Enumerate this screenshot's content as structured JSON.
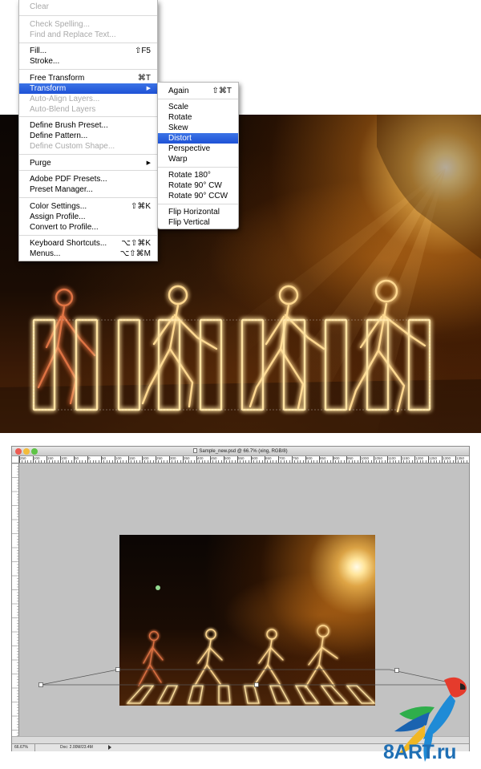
{
  "edit_menu": {
    "items": [
      {
        "label": "Clear",
        "disabled": true
      },
      {
        "label": "Check Spelling...",
        "disabled": true
      },
      {
        "label": "Find and Replace Text...",
        "disabled": true
      },
      {
        "label": "Fill...",
        "shortcut": "⇧F5"
      },
      {
        "label": "Stroke..."
      },
      {
        "label": "Free Transform",
        "shortcut": "⌘T"
      },
      {
        "label": "Transform",
        "selected": true,
        "submenu_arrow": "▶"
      },
      {
        "label": "Auto-Align Layers...",
        "disabled": true
      },
      {
        "label": "Auto-Blend Layers",
        "disabled": true
      },
      {
        "label": "Define Brush Preset..."
      },
      {
        "label": "Define Pattern..."
      },
      {
        "label": "Define Custom Shape...",
        "disabled": true
      },
      {
        "label": "Purge",
        "submenu_arrow": "▶"
      },
      {
        "label": "Adobe PDF Presets..."
      },
      {
        "label": "Preset Manager..."
      },
      {
        "label": "Color Settings...",
        "shortcut": "⇧⌘K"
      },
      {
        "label": "Assign Profile..."
      },
      {
        "label": "Convert to Profile..."
      },
      {
        "label": "Keyboard Shortcuts...",
        "shortcut": "⌥⇧⌘K"
      },
      {
        "label": "Menus...",
        "shortcut": "⌥⇧⌘M"
      }
    ]
  },
  "transform_submenu": {
    "items": [
      {
        "label": "Again",
        "shortcut": "⇧⌘T"
      },
      {
        "label": "Scale"
      },
      {
        "label": "Rotate"
      },
      {
        "label": "Skew"
      },
      {
        "label": "Distort",
        "selected": true
      },
      {
        "label": "Perspective"
      },
      {
        "label": "Warp"
      },
      {
        "label": "Rotate 180°"
      },
      {
        "label": "Rotate 90° CW"
      },
      {
        "label": "Rotate 90° CCW"
      },
      {
        "label": "Flip Horizontal"
      },
      {
        "label": "Flip Vertical"
      }
    ]
  },
  "ps_window": {
    "title": "Sample_new.psd @ 66.7% (xing, RGB/8)",
    "zoom": "66.67%",
    "doc_info": "Doc: 2.00M/23.4M",
    "ruler_labels": [
      "250",
      "200",
      "150",
      "100",
      "50",
      "0",
      "50",
      "100",
      "150",
      "200",
      "250",
      "300",
      "350",
      "400",
      "450",
      "500",
      "550",
      "600",
      "650",
      "700",
      "750",
      "800",
      "850",
      "900",
      "950",
      "1000",
      "1050",
      "1100",
      "1150",
      "1200",
      "1250",
      "1300",
      "1350"
    ],
    "traffic_colors": {
      "close": "#ec5b52",
      "minimize": "#f3bc3b",
      "zoom": "#5fc447"
    }
  },
  "watermark": {
    "text": "8ART.ru",
    "color": "#1f6fb4"
  }
}
